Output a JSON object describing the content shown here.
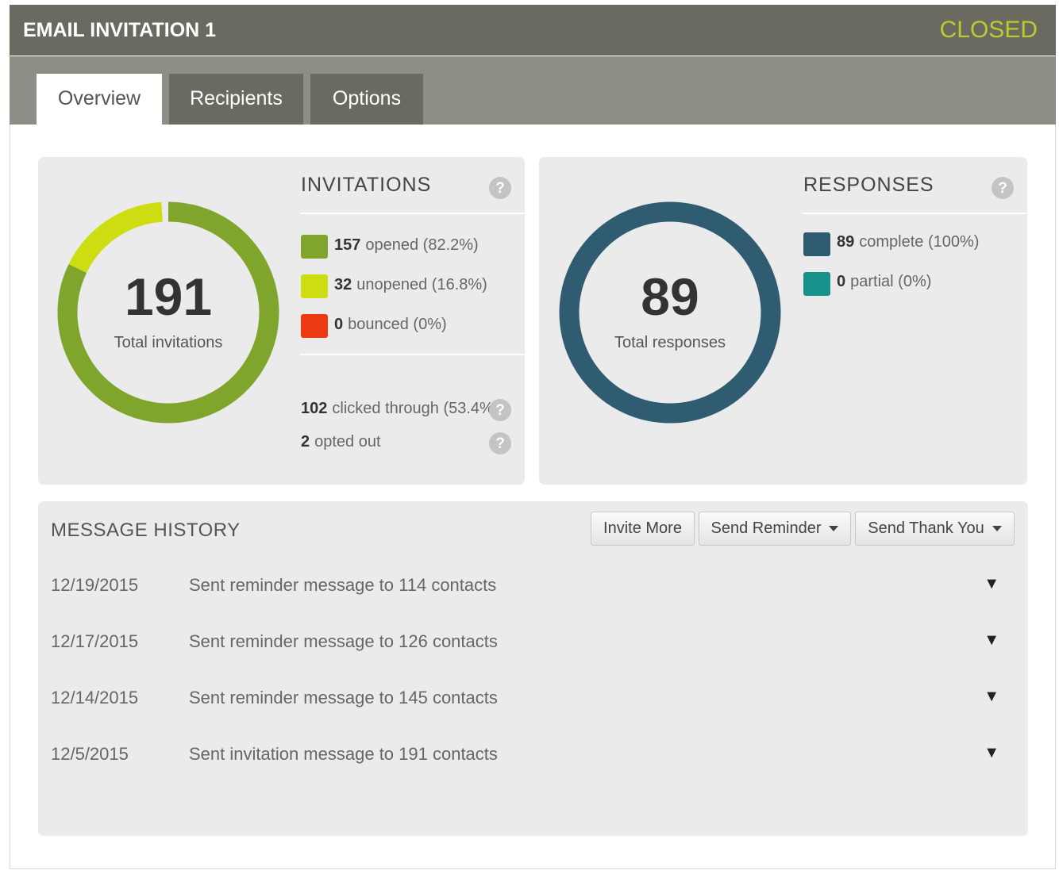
{
  "header": {
    "title": "EMAIL INVITATION 1",
    "status": "CLOSED"
  },
  "tabs": [
    {
      "label": "Overview",
      "active": true
    },
    {
      "label": "Recipients",
      "active": false
    },
    {
      "label": "Options",
      "active": false
    }
  ],
  "invitations": {
    "title": "INVITATIONS",
    "total": "191",
    "total_label": "Total invitations",
    "legend": [
      {
        "count": "157",
        "text": "opened (82.2%)",
        "color": "#7fa52d",
        "fraction": 0.822
      },
      {
        "count": "32",
        "text": "unopened (16.8%)",
        "color": "#cedd12",
        "fraction": 0.168
      },
      {
        "count": "0",
        "text": "bounced (0%)",
        "color": "#ee3a12",
        "fraction": 0.0
      }
    ],
    "clicked": {
      "count": "102",
      "text": "clicked through (53.4%)"
    },
    "opted": {
      "count": "2",
      "text": "opted out"
    }
  },
  "responses": {
    "title": "RESPONSES",
    "total": "89",
    "total_label": "Total responses",
    "legend": [
      {
        "count": "89",
        "text": "complete (100%)",
        "color": "#2f5c71",
        "fraction": 1.0
      },
      {
        "count": "0",
        "text": "partial (0%)",
        "color": "#16928a",
        "fraction": 0.0
      }
    ]
  },
  "message_history": {
    "title": "MESSAGE HISTORY",
    "buttons": {
      "invite_more": "Invite More",
      "send_reminder": "Send Reminder",
      "send_thank_you": "Send Thank You"
    },
    "rows": [
      {
        "date": "12/19/2015",
        "message": "Sent reminder message to 114 contacts",
        "arrow": "▼"
      },
      {
        "date": "12/17/2015",
        "message": "Sent reminder message to 126 contacts",
        "arrow": "▼"
      },
      {
        "date": "12/14/2015",
        "message": "Sent reminder message to 145 contacts",
        "arrow": "▼"
      },
      {
        "date": "12/5/2015",
        "message": "Sent invitation message to 191 contacts",
        "arrow": "▼"
      }
    ]
  },
  "icons": {
    "help": "help-icon",
    "expand": "expand-arrow-icon",
    "dropdown": "caret-down-icon"
  },
  "help_glyph": "?"
}
